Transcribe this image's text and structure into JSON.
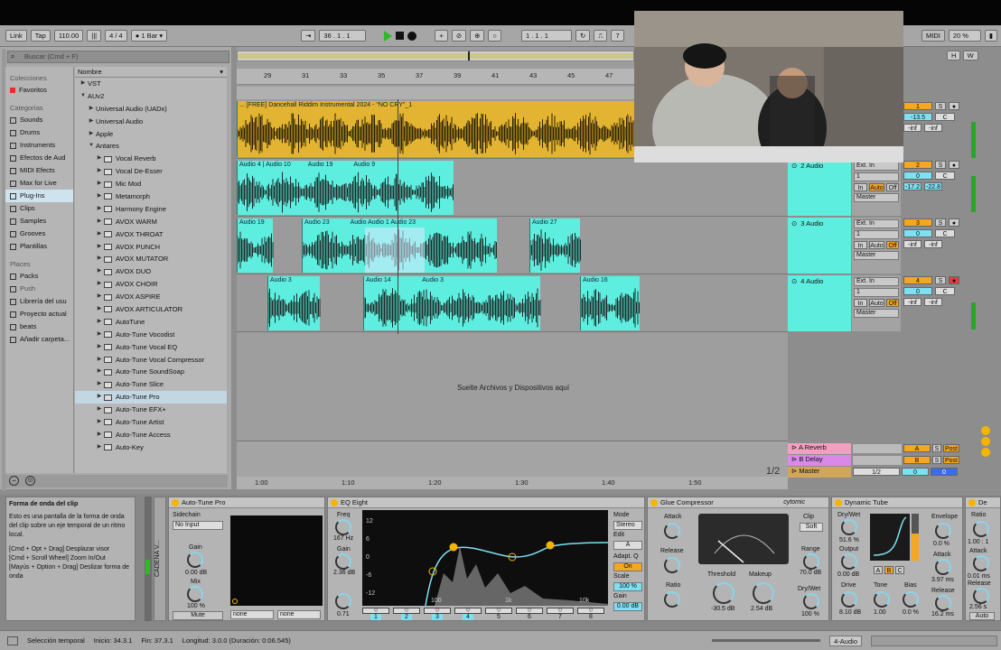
{
  "transport": {
    "link": "Link",
    "tap": "Tap",
    "tempo": "110.00",
    "meter": "4 / 4",
    "quantize": "1 Bar",
    "position": "36 . 1 . 1",
    "loop_start": "1 . 1 . 1",
    "loop_len": "7",
    "midi": "MIDI",
    "cpu": "20 %"
  },
  "browser": {
    "search_placeholder": "Buscar (Cmd + F)",
    "collections_label": "Colecciones",
    "favorites": "Favoritos",
    "categories_label": "Categorías",
    "categories": [
      "Sounds",
      "Drums",
      "Instruments",
      "Efectos de Aud",
      "MIDI Efects",
      "Max for Live",
      "Plug-Ins",
      "Clips",
      "Samples",
      "Grooves",
      "Plantillas"
    ],
    "places_label": "Places",
    "places": [
      "Packs",
      "Push",
      "Librería del usu",
      "Proyecto actual",
      "beats",
      "Añadir carpeta..."
    ],
    "column_header": "Nombre",
    "tree": [
      {
        "label": "VST",
        "indent": 0,
        "type": "folder"
      },
      {
        "label": "AUv2",
        "indent": 0,
        "type": "folder-open"
      },
      {
        "label": "Universal Audio (UADx)",
        "indent": 1,
        "type": "folder"
      },
      {
        "label": "Universal Audio",
        "indent": 1,
        "type": "folder"
      },
      {
        "label": "Apple",
        "indent": 1,
        "type": "folder"
      },
      {
        "label": "Antares",
        "indent": 1,
        "type": "folder-open"
      },
      {
        "label": "Vocal Reverb",
        "indent": 2,
        "type": "plug"
      },
      {
        "label": "Vocal De-Esser",
        "indent": 2,
        "type": "plug"
      },
      {
        "label": "Mic Mod",
        "indent": 2,
        "type": "plug"
      },
      {
        "label": "Metamorph",
        "indent": 2,
        "type": "plug"
      },
      {
        "label": "Harmony Engine",
        "indent": 2,
        "type": "plug"
      },
      {
        "label": "AVOX WARM",
        "indent": 2,
        "type": "plug"
      },
      {
        "label": "AVOX THROAT",
        "indent": 2,
        "type": "plug"
      },
      {
        "label": "AVOX PUNCH",
        "indent": 2,
        "type": "plug"
      },
      {
        "label": "AVOX MUTATOR",
        "indent": 2,
        "type": "plug"
      },
      {
        "label": "AVOX DUO",
        "indent": 2,
        "type": "plug"
      },
      {
        "label": "AVOX CHOIR",
        "indent": 2,
        "type": "plug"
      },
      {
        "label": "AVOX ASPIRE",
        "indent": 2,
        "type": "plug"
      },
      {
        "label": "AVOX ARTICULATOR",
        "indent": 2,
        "type": "plug"
      },
      {
        "label": "AutoTune",
        "indent": 2,
        "type": "plug"
      },
      {
        "label": "Auto-Tune Vocodist",
        "indent": 2,
        "type": "plug"
      },
      {
        "label": "Auto-Tune Vocal EQ",
        "indent": 2,
        "type": "plug"
      },
      {
        "label": "Auto-Tune Vocal Compressor",
        "indent": 2,
        "type": "plug"
      },
      {
        "label": "Auto-Tune SoundSoap",
        "indent": 2,
        "type": "plug"
      },
      {
        "label": "Auto-Tune Slice",
        "indent": 2,
        "type": "plug"
      },
      {
        "label": "Auto-Tune Pro",
        "indent": 2,
        "type": "plug",
        "selected": true
      },
      {
        "label": "Auto-Tune EFX+",
        "indent": 2,
        "type": "plug"
      },
      {
        "label": "Auto-Tune Artist",
        "indent": 2,
        "type": "plug"
      },
      {
        "label": "Auto-Tune Access",
        "indent": 2,
        "type": "plug"
      },
      {
        "label": "Auto-Key",
        "indent": 2,
        "type": "plug"
      }
    ]
  },
  "arrangement": {
    "ruler_bars": [
      "29",
      "31",
      "33",
      "35",
      "37",
      "39",
      "41",
      "43",
      "45",
      "47"
    ],
    "time_marks": [
      "1:00",
      "1:10",
      "1:20",
      "1:30",
      "1:40",
      "1:50"
    ],
    "drop_text": "Suelte Archivos y Dispositivos aquí",
    "page": "1/2",
    "lanes": [
      {
        "name": "1",
        "clips": [
          {
            "label": "... [FREE] Dancehall Riddim Instrumental 2024 - \"NO CRY\"_1",
            "color": "yellow"
          }
        ]
      },
      {
        "name": "2 Audio",
        "clips": [
          {
            "label": "Audio 4"
          },
          {
            "label": "Audio 10"
          },
          {
            "label": "Audio 19"
          },
          {
            "label": "Audio 9"
          }
        ]
      },
      {
        "name": "3 Audio",
        "clips": [
          {
            "label": "Audio 19"
          },
          {
            "label": "Audio 23"
          },
          {
            "label": "Audio"
          },
          {
            "label": "Audio 1"
          },
          {
            "label": "Audio 23"
          },
          {
            "label": "Audio 27"
          }
        ]
      },
      {
        "name": "4 Audio",
        "clips": [
          {
            "label": "Audio 3"
          },
          {
            "label": "Audio 14"
          },
          {
            "label": "Audio 3"
          },
          {
            "label": "Audio 16"
          }
        ]
      }
    ]
  },
  "tracks": [
    {
      "num": "1",
      "input": "",
      "ch": "",
      "vol": "-13.5",
      "pan": "C",
      "peak_l": "-inf",
      "peak_r": "-inf"
    },
    {
      "num": "2",
      "name": "2 Audio",
      "input": "Ext. In",
      "ch": "1",
      "vol": "0",
      "pan": "C",
      "peak_l": "-17.2",
      "peak_r": "-22.8",
      "out": "Master",
      "in": "In",
      "auto": "Auto",
      "off": "Off"
    },
    {
      "num": "3",
      "name": "3 Audio",
      "input": "Ext. In",
      "ch": "1",
      "vol": "0",
      "pan": "C",
      "peak_l": "-inf",
      "peak_r": "-inf",
      "out": "Master",
      "in": "In",
      "auto": "Auto",
      "off": "Off"
    },
    {
      "num": "4",
      "name": "4 Audio",
      "input": "Ext. In",
      "ch": "1",
      "vol": "0",
      "pan": "C",
      "peak_l": "-inf",
      "peak_r": "-inf",
      "out": "Master",
      "in": "In",
      "auto": "Auto",
      "off": "Off"
    }
  ],
  "returns": [
    {
      "name": "A Reverb",
      "letter": "A",
      "post": "Post"
    },
    {
      "name": "B Delay",
      "letter": "B",
      "post": "Post"
    },
    {
      "name": "Master",
      "out": "1/2",
      "vol": "0",
      "pan": "0"
    }
  ],
  "info": {
    "title": "Forma de onda del clip",
    "body": "Esto es una pantalla de la forma de onda del clip sobre un eje temporal de un ritmo local.",
    "hints": "[Cmd + Opt + Drag] Desplazar visor\n[Cmd + Scroll Wheel] Zoom In/Out\n[Mayús + Option + Drag] Deslizar forma de onda"
  },
  "devices": {
    "chain_label": "CADENA V...",
    "autotune": {
      "title": "Auto-Tune Pro",
      "sidechain": "Sidechain",
      "input": "No Input",
      "gain_label": "Gain",
      "gain": "0.00 dB",
      "mix_label": "Mix",
      "mix": "100 %",
      "mute": "Mute",
      "sel1": "none",
      "sel2": "none"
    },
    "eq": {
      "title": "EQ Eight",
      "freq_label": "Freq",
      "freq": "167 Hz",
      "gain_label": "Gain",
      "gain": "2.36 dB",
      "q": "0.71",
      "mode_label": "Mode",
      "mode": "Stereo",
      "edit_label": "Edit",
      "edit": "A",
      "adapt": "Adapt. Q",
      "on": "On",
      "scale_label": "Scale",
      "scale": "100 %",
      "gain2_label": "Gain",
      "gain2": "0.00 dB",
      "db_labels": [
        "12",
        "6",
        "0",
        "-6",
        "-12"
      ],
      "freq_ticks": [
        "100",
        "1k",
        "10k"
      ],
      "bands": [
        "1",
        "2",
        "3",
        "4",
        "5",
        "6",
        "7",
        "8"
      ]
    },
    "glue": {
      "title": "Glue Compressor",
      "brand": "cytomic",
      "attack_label": "Attack",
      "release_label": "Release",
      "ratio_label": "Ratio",
      "threshold_label": "Threshold",
      "threshold": "-30.5 dB",
      "makeup_label": "Makeup",
      "makeup": "2.54 dB",
      "clip": "Clip",
      "soft": "Soft",
      "range_label": "Range",
      "range": "70.0 dB",
      "drywet_label": "Dry/Wet",
      "drywet": "100 %"
    },
    "tube": {
      "title": "Dynamic Tube",
      "drywet_label": "Dry/Wet",
      "drywet": "51.6 %",
      "output_label": "Output",
      "output": "0.00 dB",
      "drive_label": "Drive",
      "drive": "8.10 dB",
      "tone_label": "Tone",
      "tone": "1.00",
      "bias_label": "Bias",
      "bias": "0.0 %",
      "envelope_label": "Envelope",
      "envelope": "0.0 %",
      "attack_label": "Attack",
      "attack": "3.97 ms",
      "release_label": "Release",
      "release": "16.2 ms",
      "modes": [
        "A",
        "B",
        "C"
      ]
    },
    "next": {
      "title": "De",
      "ratio_label": "Ratio",
      "ratio": "1.00 : 1",
      "attack_label": "Attack",
      "attack": "0.01 ms",
      "release_label": "Release",
      "release": "2.56 s",
      "auto": "Auto"
    }
  },
  "status": {
    "selection": "Selección temporal",
    "start": "Inicio: 34.3.1",
    "end": "Fin: 37.3.1",
    "length": "Longitud: 3.0.0 (Duración: 0:06.545)",
    "track": "4-Audio"
  }
}
